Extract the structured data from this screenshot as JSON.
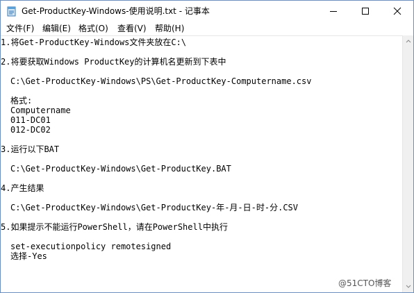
{
  "window": {
    "title": "Get-ProductKey-Windows-使用说明.txt - 记事本"
  },
  "menu": {
    "file": "文件(F)",
    "edit": "编辑(E)",
    "format": "格式(O)",
    "view": "查看(V)",
    "help": "帮助(H)"
  },
  "content": {
    "lines": [
      "1.将Get-ProductKey-Windows文件夹放在C:\\",
      "2.将要获取Windows ProductKey的计算机名更新到下表中",
      "C:\\Get-ProductKey-Windows\\PS\\Get-ProductKey-Computername.csv",
      "格式:",
      "Computername",
      "011-DC01",
      "012-DC02",
      "3.运行以下BAT",
      "C:\\Get-ProductKey-Windows\\Get-ProductKey.BAT",
      "4.产生结果",
      "C:\\Get-ProductKey-Windows\\Get-ProductKey-年-月-日-时-分.CSV",
      "5.如果提示不能运行PowerShell，请在PowerShell中执行",
      "set-executionpolicy remotesigned",
      "选择-Yes"
    ]
  },
  "watermark": "@51CTO博客",
  "icons": {
    "app": "notepad-icon",
    "minimize": "minimize-icon",
    "maximize": "maximize-icon",
    "close": "close-icon"
  }
}
